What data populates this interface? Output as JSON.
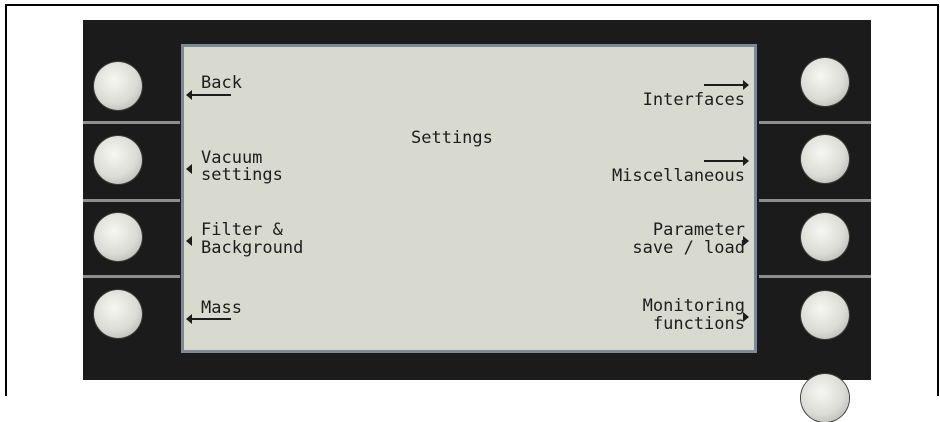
{
  "screen": {
    "title": "Settings",
    "left_menu": [
      {
        "key": "back",
        "lines": [
          "Back"
        ]
      },
      {
        "key": "vacuum",
        "lines": [
          "Vacuum",
          "settings"
        ]
      },
      {
        "key": "filter",
        "lines": [
          "Filter &",
          "Background"
        ]
      },
      {
        "key": "mass",
        "lines": [
          "Mass"
        ]
      }
    ],
    "right_menu": [
      {
        "key": "interfaces",
        "lines": [
          "Interfaces"
        ]
      },
      {
        "key": "misc",
        "lines": [
          "Miscellaneous"
        ]
      },
      {
        "key": "parameter",
        "lines": [
          "Parameter",
          "save / load"
        ]
      },
      {
        "key": "monitoring",
        "lines": [
          "Monitoring",
          "functions"
        ]
      }
    ]
  },
  "colors": {
    "bezel": "#1b1b1b",
    "lcd": "#d8d9cf",
    "lcd_border": "#7f8895",
    "text": "#1d1d1d",
    "softkey": "#dcdcd6"
  }
}
